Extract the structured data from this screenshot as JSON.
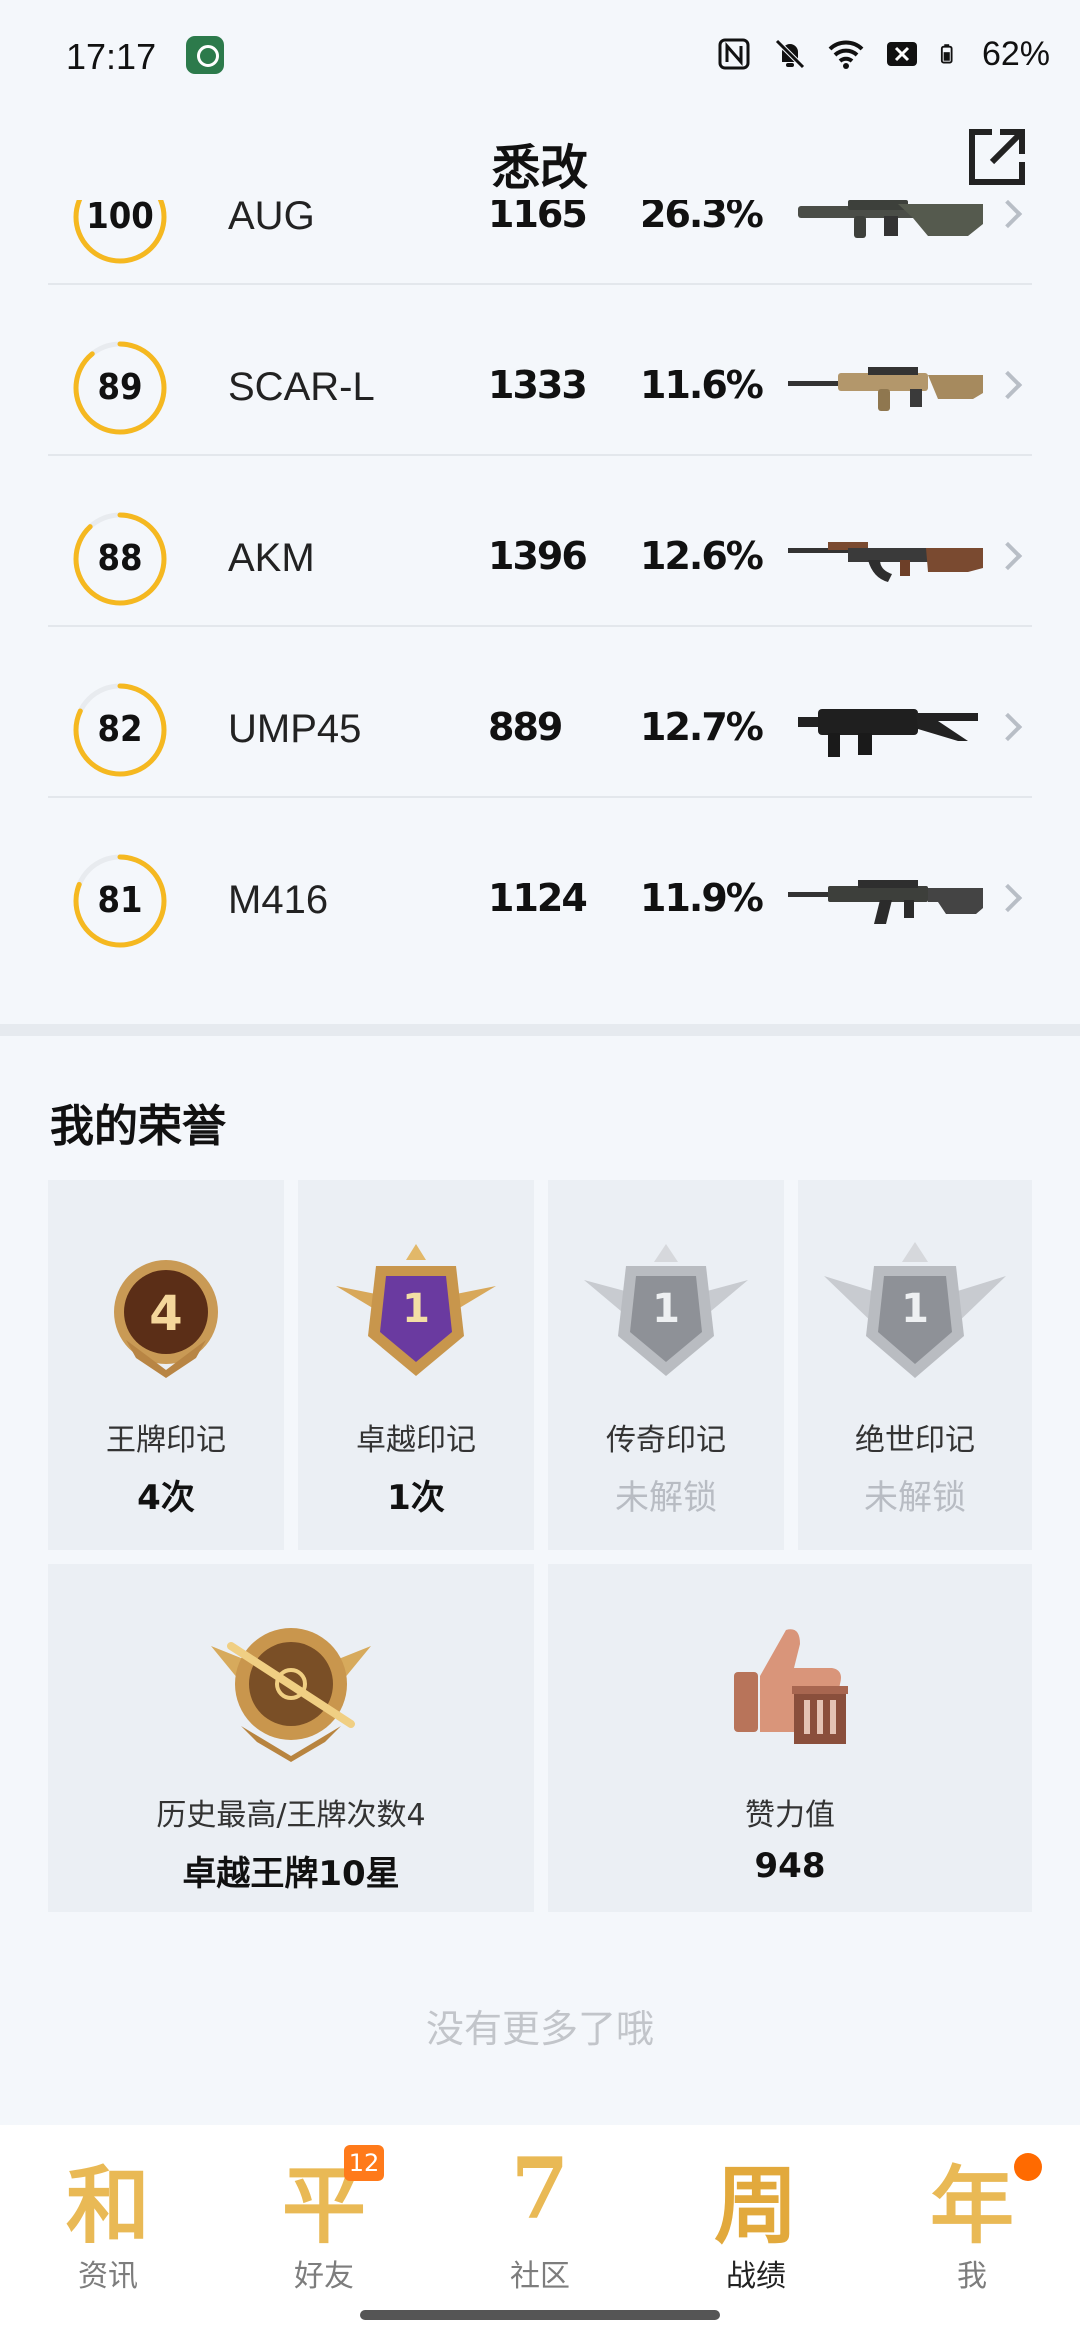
{
  "status_bar": {
    "time": "17:17",
    "battery": "62%"
  },
  "header": {
    "title": "悉改"
  },
  "weapons": [
    {
      "score": "100",
      "score_value": 100,
      "name": "AUG",
      "kills": "1165",
      "rate": "26.3%"
    },
    {
      "score": "89",
      "score_value": 89,
      "name": "SCAR-L",
      "kills": "1333",
      "rate": "11.6%"
    },
    {
      "score": "88",
      "score_value": 88,
      "name": "AKM",
      "kills": "1396",
      "rate": "12.6%"
    },
    {
      "score": "82",
      "score_value": 82,
      "name": "UMP45",
      "kills": "889",
      "rate": "12.7%"
    },
    {
      "score": "81",
      "score_value": 81,
      "name": "M416",
      "kills": "1124",
      "rate": "11.9%"
    }
  ],
  "honors": {
    "title": "我的荣誉",
    "marks": [
      {
        "number": "4",
        "label": "王牌印记",
        "value": "4次",
        "locked": false
      },
      {
        "number": "1",
        "label": "卓越印记",
        "value": "1次",
        "locked": false
      },
      {
        "number": "1",
        "label": "传奇印记",
        "value": "未解锁",
        "locked": true
      },
      {
        "number": "1",
        "label": "绝世印记",
        "value": "未解锁",
        "locked": true
      }
    ],
    "highest": {
      "label": "历史最高/王牌次数4",
      "value": "卓越王牌10星"
    },
    "likes": {
      "label": "赞力值",
      "value": "948"
    }
  },
  "footer_note": "没有更多了哦",
  "tabbar": {
    "tabs": [
      {
        "glyph": "和",
        "label": "资讯",
        "active": false
      },
      {
        "glyph": "平",
        "label": "好友",
        "badge": "12",
        "active": false
      },
      {
        "glyph": "7",
        "label": "社区",
        "active": false
      },
      {
        "glyph": "周",
        "label": "战绩",
        "active": true
      },
      {
        "glyph": "年",
        "label": "我",
        "active": false,
        "dot": true
      }
    ]
  },
  "colors": {
    "ring_active": "#f5b820",
    "ring_track": "#e8ebef",
    "accent_orange": "#ff7a1a",
    "tab_gold": "#e9b955"
  }
}
